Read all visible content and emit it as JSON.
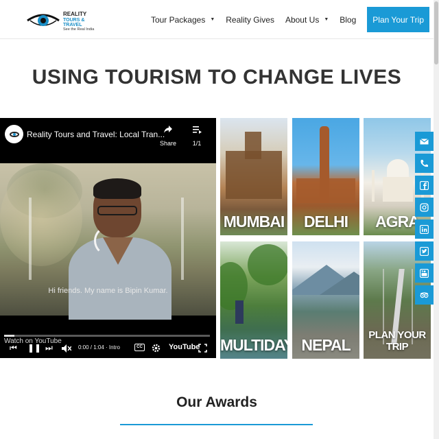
{
  "brand": {
    "name_line1": "REALITY",
    "name_line2": "TOURS & TRAVEL",
    "tagline": "See the Real India",
    "accent_color": "#1a9ad6"
  },
  "nav": {
    "items": [
      {
        "label": "Tour Packages",
        "has_dropdown": true
      },
      {
        "label": "Reality Gives",
        "has_dropdown": false
      },
      {
        "label": "About Us",
        "has_dropdown": true
      },
      {
        "label": "Blog",
        "has_dropdown": false
      }
    ],
    "cta_label": "Plan Your Trip"
  },
  "hero": {
    "title": "USING TOURISM TO CHANGE LIVES"
  },
  "video": {
    "title": "Reality Tours and Travel: Local Tran...",
    "share_label": "Share",
    "queue_count": "1/1",
    "caption": "Hi friends. My name is Bipin Kumar.",
    "watch_on": "Watch on",
    "watch_on_brand": "YouTube",
    "time": "0:00 / 1:04",
    "chapter": "Intro",
    "cc_label": "CC",
    "logo": "YouTube",
    "progress_fraction": 0.05
  },
  "destinations": [
    {
      "label": "MUMBAI"
    },
    {
      "label": "DELHI"
    },
    {
      "label": "AGRA"
    },
    {
      "label": "MULTIDAY"
    },
    {
      "label": "NEPAL"
    },
    {
      "label": "PLAN YOUR TRIP"
    }
  ],
  "social": {
    "icons": [
      "mail-icon",
      "phone-icon",
      "facebook-icon",
      "instagram-icon",
      "linkedin-icon",
      "twitter-icon",
      "youtube-icon",
      "tripadvisor-icon"
    ]
  },
  "awards": {
    "title": "Our Awards"
  }
}
